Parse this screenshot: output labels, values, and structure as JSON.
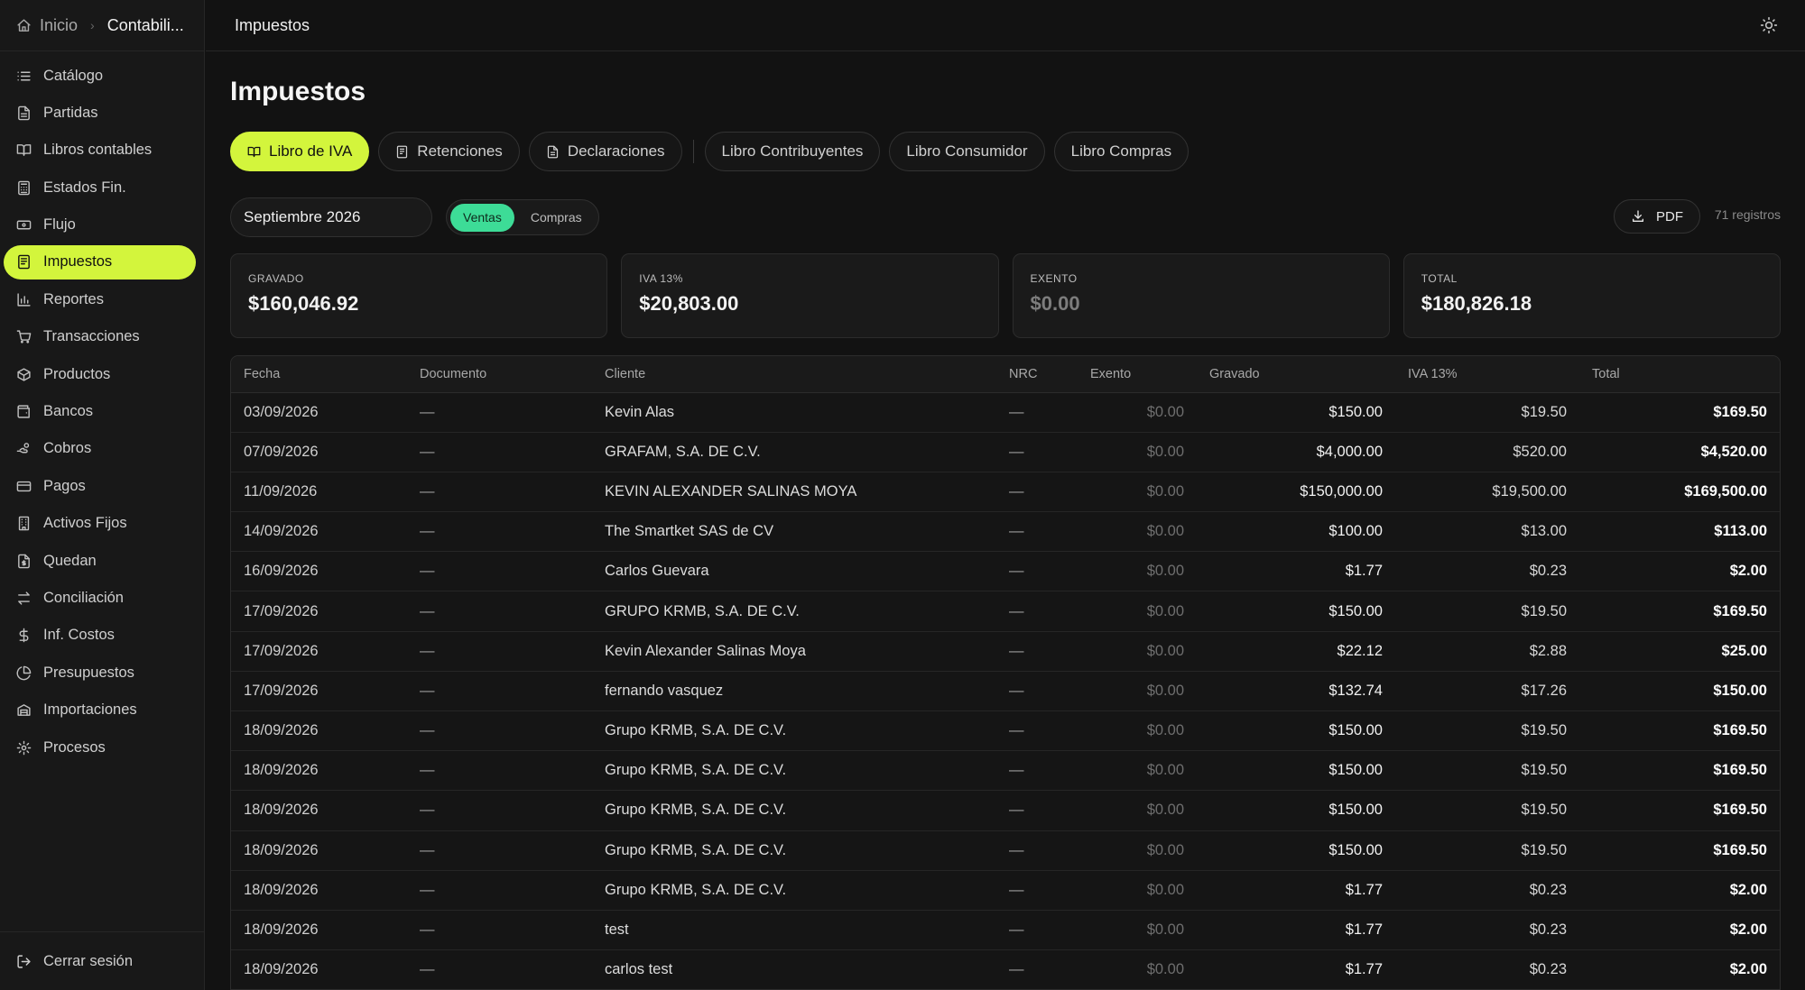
{
  "sidebar": {
    "breadcrumb": {
      "home": "Inicio",
      "current": "Contabili..."
    },
    "items": [
      {
        "label": "Catálogo",
        "icon": "list-icon"
      },
      {
        "label": "Partidas",
        "icon": "document-icon"
      },
      {
        "label": "Libros contables",
        "icon": "book-open-icon"
      },
      {
        "label": "Estados Fin.",
        "icon": "calculator-icon"
      },
      {
        "label": "Flujo",
        "icon": "banknote-icon"
      },
      {
        "label": "Impuestos",
        "icon": "receipt-icon",
        "active": true
      },
      {
        "label": "Reportes",
        "icon": "bar-chart-icon"
      },
      {
        "label": "Transacciones",
        "icon": "cart-icon"
      },
      {
        "label": "Productos",
        "icon": "package-icon"
      },
      {
        "label": "Bancos",
        "icon": "wallet-icon"
      },
      {
        "label": "Cobros",
        "icon": "hand-coins-icon"
      },
      {
        "label": "Pagos",
        "icon": "credit-card-icon"
      },
      {
        "label": "Activos Fijos",
        "icon": "building-icon"
      },
      {
        "label": "Quedan",
        "icon": "file-dollar-icon"
      },
      {
        "label": "Conciliación",
        "icon": "arrows-swap-icon"
      },
      {
        "label": "Inf. Costos",
        "icon": "dollar-icon"
      },
      {
        "label": "Presupuestos",
        "icon": "pie-chart-icon"
      },
      {
        "label": "Importaciones",
        "icon": "container-icon"
      },
      {
        "label": "Procesos",
        "icon": "gear-icon"
      }
    ],
    "logout": "Cerrar sesión"
  },
  "header": {
    "title": "Impuestos"
  },
  "page": {
    "title": "Impuestos"
  },
  "tabs": [
    {
      "label": "Libro de IVA",
      "icon": "book-open-icon",
      "active": true
    },
    {
      "label": "Retenciones",
      "icon": "receipt-icon"
    },
    {
      "label": "Declaraciones",
      "icon": "document-icon"
    },
    {
      "label": "Libro Contribuyentes"
    },
    {
      "label": "Libro Consumidor"
    },
    {
      "label": "Libro Compras"
    }
  ],
  "controls": {
    "period": "Septiembre 2026",
    "toggle": {
      "ventas": "Ventas",
      "compras": "Compras"
    },
    "pdf": "PDF",
    "registros": "71 registros"
  },
  "cards": [
    {
      "label": "GRAVADO",
      "value": "$160,046.92"
    },
    {
      "label": "IVA 13%",
      "value": "$20,803.00"
    },
    {
      "label": "EXENTO",
      "value": "$0.00"
    },
    {
      "label": "TOTAL",
      "value": "$180,826.18"
    }
  ],
  "table": {
    "headers": [
      "Fecha",
      "Documento",
      "Cliente",
      "NRC",
      "Exento",
      "Gravado",
      "IVA 13%",
      "Total"
    ],
    "rows": [
      [
        "03/09/2026",
        "—",
        "Kevin Alas",
        "—",
        "$0.00",
        "$150.00",
        "$19.50",
        "$169.50"
      ],
      [
        "07/09/2026",
        "—",
        "GRAFAM, S.A. DE C.V.",
        "—",
        "$0.00",
        "$4,000.00",
        "$520.00",
        "$4,520.00"
      ],
      [
        "11/09/2026",
        "—",
        "KEVIN ALEXANDER SALINAS MOYA",
        "—",
        "$0.00",
        "$150,000.00",
        "$19,500.00",
        "$169,500.00"
      ],
      [
        "14/09/2026",
        "—",
        "The Smartket SAS de CV",
        "—",
        "$0.00",
        "$100.00",
        "$13.00",
        "$113.00"
      ],
      [
        "16/09/2026",
        "—",
        "Carlos Guevara",
        "—",
        "$0.00",
        "$1.77",
        "$0.23",
        "$2.00"
      ],
      [
        "17/09/2026",
        "—",
        "GRUPO KRMB, S.A. DE C.V.",
        "—",
        "$0.00",
        "$150.00",
        "$19.50",
        "$169.50"
      ],
      [
        "17/09/2026",
        "—",
        "Kevin Alexander Salinas Moya",
        "—",
        "$0.00",
        "$22.12",
        "$2.88",
        "$25.00"
      ],
      [
        "17/09/2026",
        "—",
        "fernando vasquez",
        "—",
        "$0.00",
        "$132.74",
        "$17.26",
        "$150.00"
      ],
      [
        "18/09/2026",
        "—",
        "Grupo KRMB, S.A. DE C.V.",
        "—",
        "$0.00",
        "$150.00",
        "$19.50",
        "$169.50"
      ],
      [
        "18/09/2026",
        "—",
        "Grupo KRMB, S.A. DE C.V.",
        "—",
        "$0.00",
        "$150.00",
        "$19.50",
        "$169.50"
      ],
      [
        "18/09/2026",
        "—",
        "Grupo KRMB, S.A. DE C.V.",
        "—",
        "$0.00",
        "$150.00",
        "$19.50",
        "$169.50"
      ],
      [
        "18/09/2026",
        "—",
        "Grupo KRMB, S.A. DE C.V.",
        "—",
        "$0.00",
        "$150.00",
        "$19.50",
        "$169.50"
      ],
      [
        "18/09/2026",
        "—",
        "Grupo KRMB, S.A. DE C.V.",
        "—",
        "$0.00",
        "$1.77",
        "$0.23",
        "$2.00"
      ],
      [
        "18/09/2026",
        "—",
        "test",
        "—",
        "$0.00",
        "$1.77",
        "$0.23",
        "$2.00"
      ],
      [
        "18/09/2026",
        "—",
        "carlos test",
        "—",
        "$0.00",
        "$1.77",
        "$0.23",
        "$2.00"
      ]
    ]
  },
  "colors": {
    "accent": "#d3f53c",
    "toggle_on": "#3ddc97",
    "background": "#121212"
  }
}
